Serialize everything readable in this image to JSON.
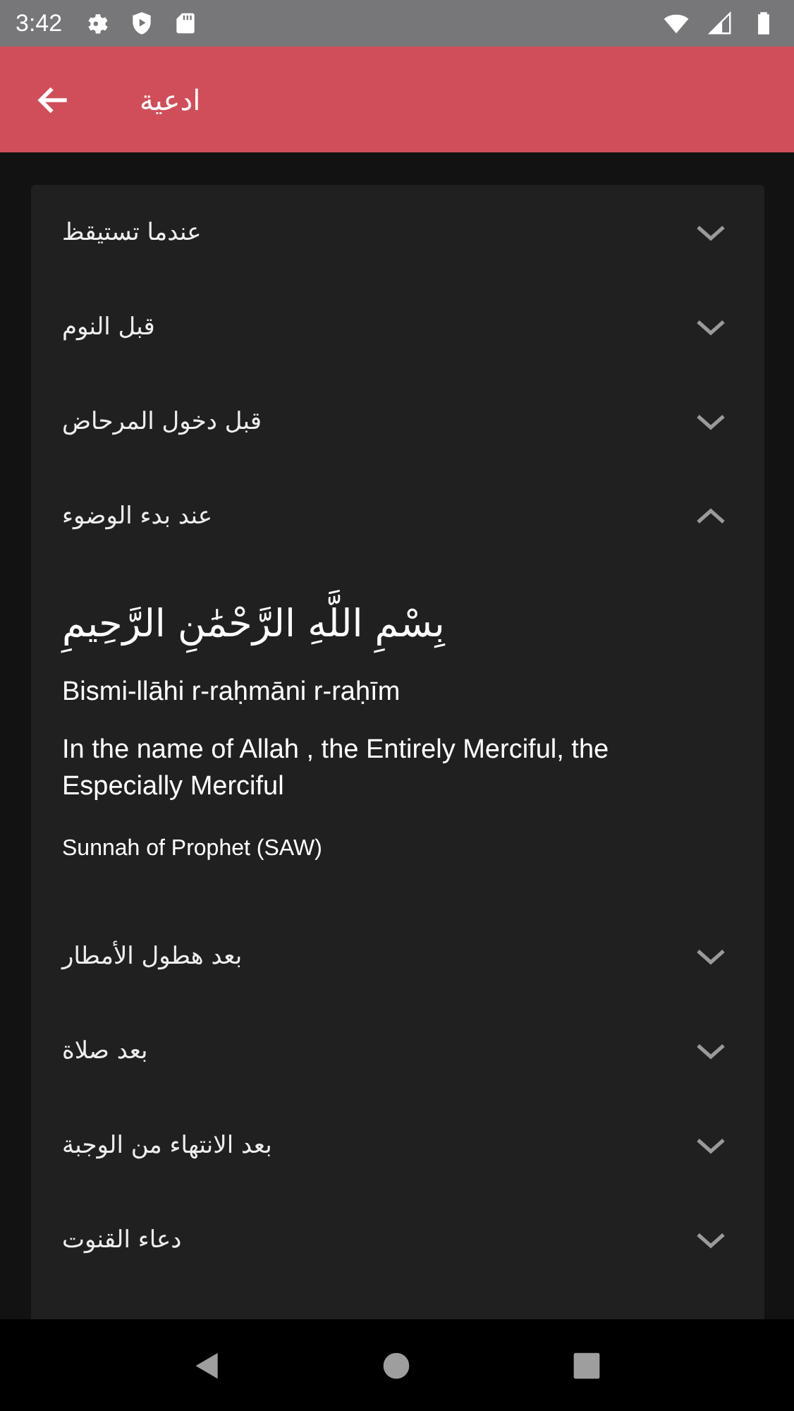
{
  "status_bar": {
    "time": "3:42"
  },
  "app_bar": {
    "title": "ادعية"
  },
  "items": [
    {
      "title": "عندما تستيقظ",
      "expanded": false
    },
    {
      "title": "قبل النوم",
      "expanded": false
    },
    {
      "title": "قبل دخول المرحاض",
      "expanded": false
    },
    {
      "title": "عند بدء الوضوء",
      "expanded": true,
      "arabic": "بِسْمِ اللَّهِ الرَّحْمَٰنِ الرَّحِيمِ",
      "transliteration": "Bismi-llāhi r-raḥmāni r-raḥīm",
      "translation": "In the name of Allah , the Entirely Merciful, the Especially Merciful",
      "source": "Sunnah of Prophet (SAW)"
    },
    {
      "title": "بعد هطول الأمطار",
      "expanded": false
    },
    {
      "title": "بعد صلاة",
      "expanded": false
    },
    {
      "title": "بعد الانتهاء من الوجبة",
      "expanded": false
    },
    {
      "title": "دعاء القنوت",
      "expanded": false
    }
  ]
}
